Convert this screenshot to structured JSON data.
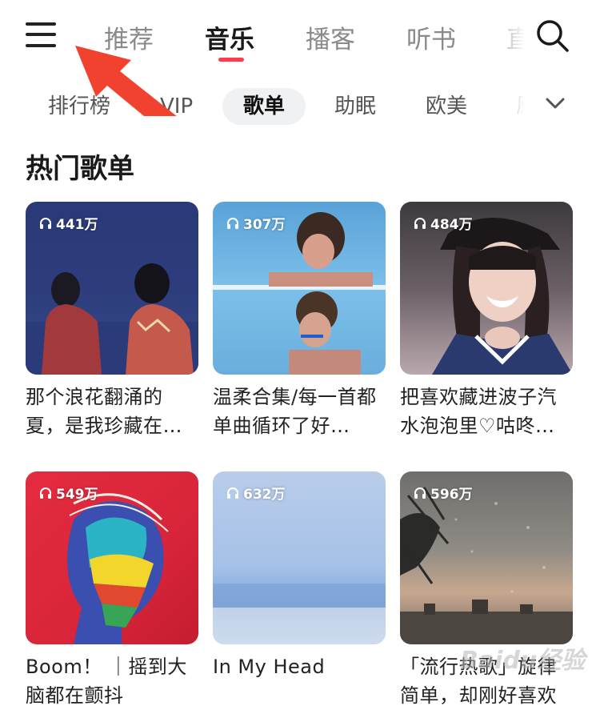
{
  "top_tabs": [
    "推荐",
    "音乐",
    "播客",
    "听书",
    "直"
  ],
  "active_top_tab": "音乐",
  "sub_tabs": [
    "排行榜",
    "VIP",
    "歌单",
    "助眠",
    "欧美",
    "原"
  ],
  "active_sub_tab": "歌单",
  "section_title": "热门歌单",
  "accent_color": "#ff3a4a",
  "playlists": [
    {
      "plays": "441万",
      "title": "那个浪花翻涌的夏，是我珍藏在…"
    },
    {
      "plays": "307万",
      "title": "温柔合集/每一首都单曲循环了好…"
    },
    {
      "plays": "484万",
      "title": "把喜欢藏进波子汽水泡泡里♡咕咚…"
    },
    {
      "plays": "549万",
      "title": "Boom！ ｜摇到大脑都在颤抖"
    },
    {
      "plays": "632万",
      "title": "In My Head"
    },
    {
      "plays": "596万",
      "title": "「流行热歌」旋律简单，却刚好喜欢"
    }
  ],
  "watermark": "Baidu经验"
}
